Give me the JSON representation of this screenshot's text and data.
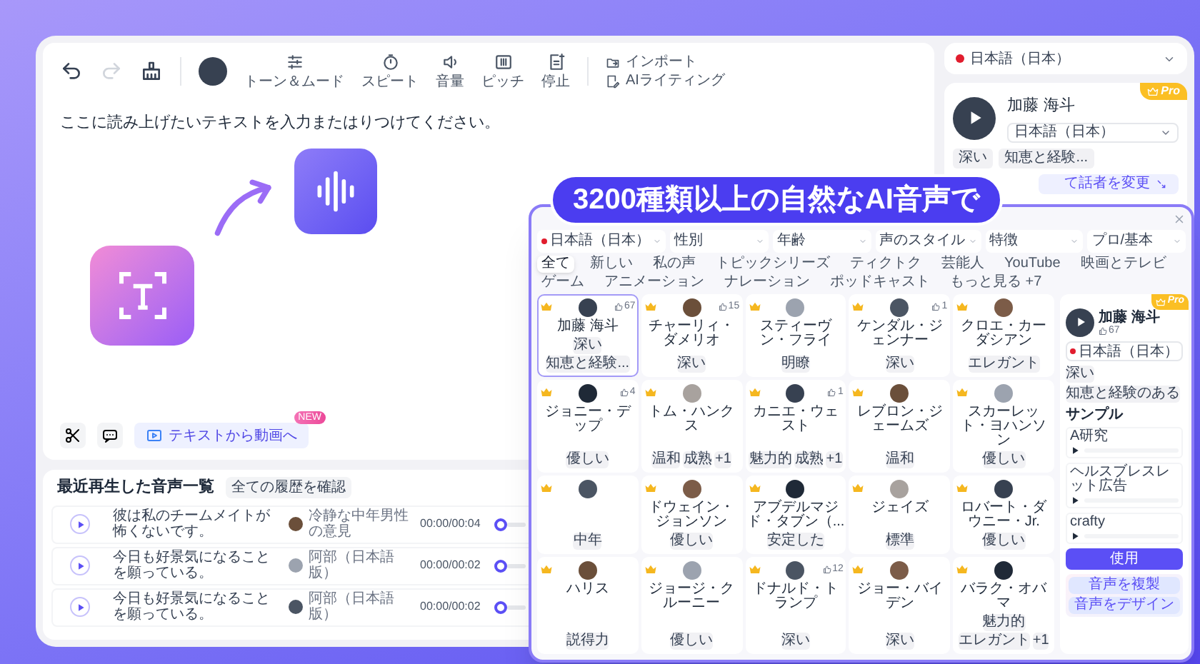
{
  "editor": {
    "tools": [
      {
        "kind": "tone",
        "label": "トーン＆ムード"
      },
      {
        "kind": "speed",
        "label": "スピート"
      },
      {
        "kind": "volume",
        "label": "音量"
      },
      {
        "kind": "pitch",
        "label": "ピッチ"
      },
      {
        "kind": "pause",
        "label": "停止"
      }
    ],
    "side_actions": [
      {
        "kind": "import",
        "label": "インポート"
      },
      {
        "kind": "ai",
        "label": "AIライティング"
      }
    ],
    "placeholder": "ここに読み上げたいテキストを入力またはりつけてください。",
    "video_button": {
      "label": "テキストから動画へ",
      "badge": "NEW"
    }
  },
  "history": {
    "title": "最近再生した音声一覧",
    "link": "全ての履歴を確認",
    "rows": [
      {
        "text": "彼は私のチームメイトが怖くないです。",
        "voice": "冷静な中年男性の意見",
        "time": "00:00/00:04",
        "level": 0
      },
      {
        "text": "今日も好景気になることを願っている。",
        "voice": "阿部（日本語版）",
        "time": "00:00/00:02",
        "level": 0
      },
      {
        "text": "今日も好景気になることを願っている。",
        "voice": "阿部（日本語版）",
        "time": "00:00/00:02",
        "level": 0
      }
    ]
  },
  "right_panel": {
    "language": "日本語（日本）",
    "voice": {
      "name": "加藤 海斗",
      "language": "日本語（日本）",
      "badge": "Pro",
      "tags": [
        "深い",
        "知恵と経験..."
      ]
    },
    "change_button": "て話者を変更"
  },
  "banner": "3200種類以上の自然なAI音声で",
  "library": {
    "filters": [
      "日本語（日本）",
      "性別",
      "年齢",
      "声のスタイル",
      "特徴",
      "プロ/基本"
    ],
    "categories": [
      {
        "label": "全て",
        "selected": true
      },
      {
        "label": "新しい",
        "selected": false
      },
      {
        "label": "私の声",
        "selected": false
      },
      {
        "label": "トピックシリーズ",
        "selected": false
      },
      {
        "label": "ティクトク",
        "selected": false
      },
      {
        "label": "芸能人",
        "selected": false
      },
      {
        "label": "YouTube",
        "selected": false
      },
      {
        "label": "映画とテレビ",
        "selected": false
      },
      {
        "label": "ゲーム",
        "selected": false
      },
      {
        "label": "アニメーション",
        "selected": false
      },
      {
        "label": "ナレーション",
        "selected": false
      },
      {
        "label": "ポッドキャスト",
        "selected": false
      },
      {
        "label": "もっと見る +7",
        "selected": false
      }
    ],
    "voices": [
      {
        "name": "加藤 海斗",
        "count": "67",
        "tags": [
          "深い",
          "知恵と経験..."
        ],
        "selected": true
      },
      {
        "name": "チャーリィ・ダメリオ",
        "count": "15",
        "tags": [
          "深い"
        ],
        "selected": false
      },
      {
        "name": "スティーヴン・フライ",
        "tags": [
          "明瞭"
        ],
        "selected": false
      },
      {
        "name": "ケンダル・ジェンナー",
        "count": "1",
        "tags": [
          "深い"
        ],
        "selected": false
      },
      {
        "name": "クロエ・カーダシアン",
        "tags": [
          "エレガント"
        ],
        "selected": false
      },
      {
        "name": "ジョニー・デップ",
        "count": "4",
        "tags": [
          "優しい"
        ],
        "selected": false
      },
      {
        "name": "トム・ハンクス",
        "tags": [
          "温和",
          "成熟",
          "+1"
        ],
        "selected": false
      },
      {
        "name": "カニエ・ウェスト",
        "count": "1",
        "tags": [
          "魅力的",
          "成熟",
          "+1"
        ],
        "selected": false
      },
      {
        "name": "レブロン・ジェームズ",
        "tags": [
          "温和"
        ],
        "selected": false
      },
      {
        "name": "スカーレット・ヨハンソン",
        "tags": [
          "優しい"
        ],
        "selected": false
      },
      {
        "tags": [
          "中年"
        ],
        "selected": false
      },
      {
        "name": "ドウェイン・ジョンソン",
        "tags": [
          "優しい"
        ],
        "selected": false
      },
      {
        "name": "アブデルマジド・タブン（...",
        "tags": [
          "安定した"
        ],
        "selected": false
      },
      {
        "name": "ジェイズ",
        "tags": [
          "標準"
        ],
        "selected": false
      },
      {
        "name": "ロバート・ダウニー・Jr.",
        "tags": [
          "優しい"
        ],
        "selected": false
      },
      {
        "name": "ハリス",
        "tags": [
          "説得力"
        ],
        "selected": false
      },
      {
        "name": "ジョージ・クルーニー",
        "tags": [
          "優しい"
        ],
        "selected": false
      },
      {
        "name": "ドナルド・トランプ",
        "count": "12",
        "tags": [
          "深い"
        ],
        "selected": false
      },
      {
        "name": "ジョー・バイデン",
        "tags": [
          "深い"
        ],
        "selected": false
      },
      {
        "name": "バラク・オバマ",
        "tags": [
          "魅力的",
          "エレガント",
          "+1"
        ],
        "selected": false
      }
    ],
    "detail": {
      "name": "加藤 海斗",
      "count": "67",
      "badge": "Pro",
      "language": "日本語（日本）",
      "tags": [
        "深い",
        "知恵と経験のある"
      ],
      "samples_title": "サンプル",
      "samples": [
        {
          "label": "A研究",
          "level": 0
        },
        {
          "label": "ヘルスブレスレット広告",
          "level": 0
        },
        {
          "label": "crafty",
          "level": 0
        }
      ],
      "use_button": "使用",
      "actions": [
        "音声を複製",
        "音声をデザイン"
      ]
    }
  }
}
